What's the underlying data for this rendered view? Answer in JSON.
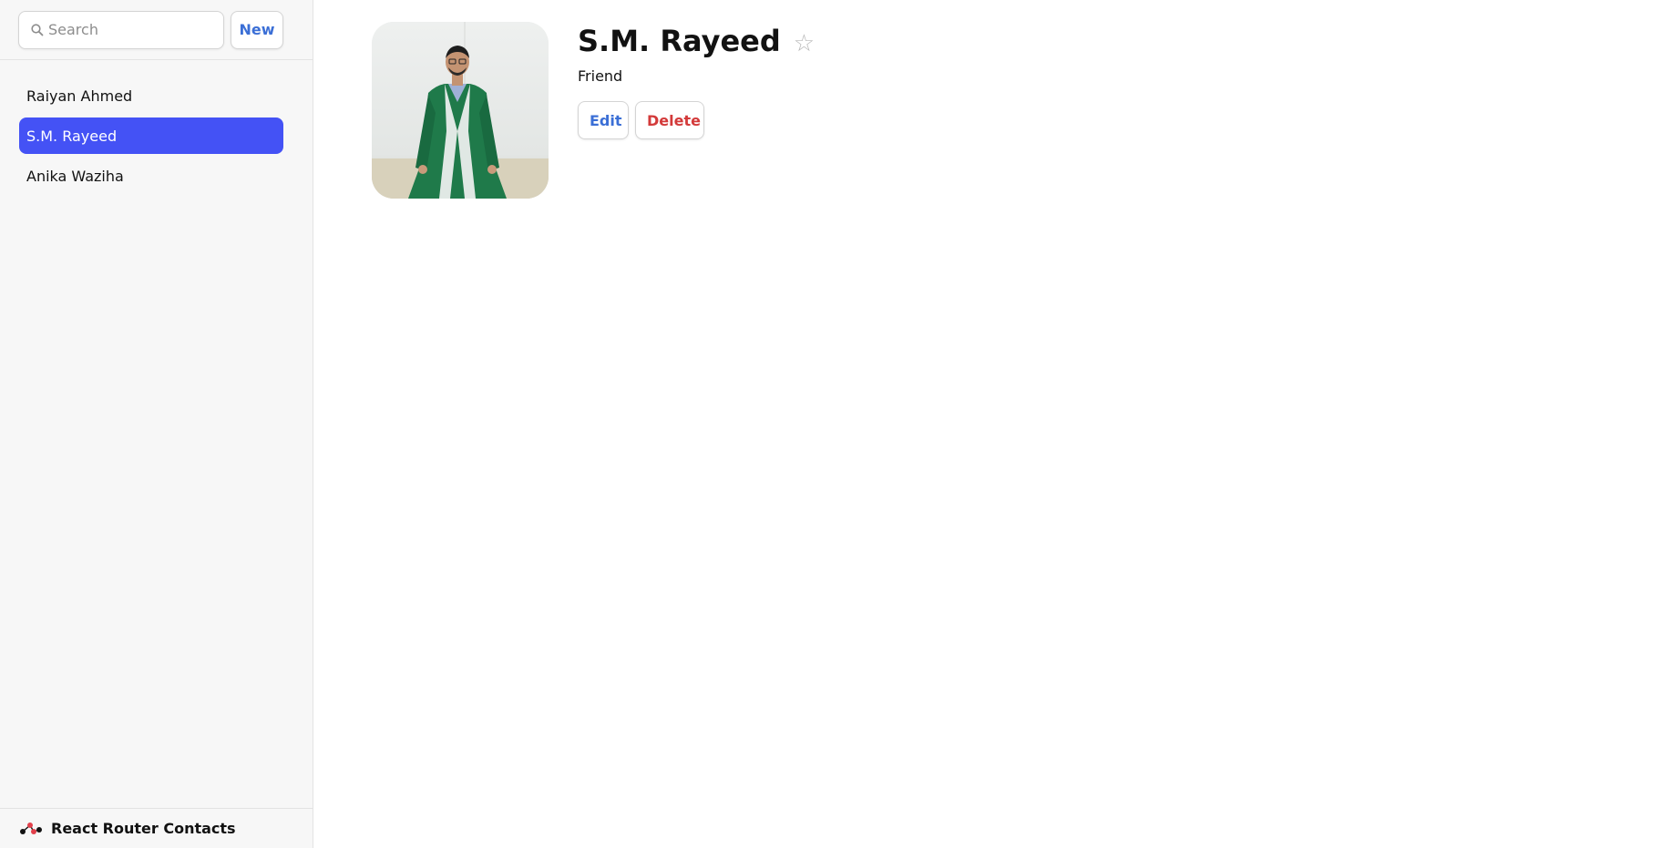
{
  "sidebar": {
    "search": {
      "placeholder": "Search",
      "value": ""
    },
    "new_label": "New",
    "contacts": [
      {
        "label": "Raiyan Ahmed",
        "active": false
      },
      {
        "label": "S.M. Rayeed",
        "active": true
      },
      {
        "label": "Anika Waziha",
        "active": false
      }
    ],
    "footer_title": "React Router Contacts"
  },
  "contact": {
    "name": "S.M. Rayeed",
    "relation": "Friend",
    "favorite": false,
    "favorite_glyph": "☆",
    "edit_label": "Edit",
    "delete_label": "Delete"
  },
  "colors": {
    "accent": "#4452f5",
    "link": "#3b6fd6",
    "danger": "#d33a3a",
    "gown": "#1f7a4a"
  },
  "icons": {
    "search": "search-icon",
    "favorite": "star-outline-icon",
    "logo": "react-router-logo-icon"
  }
}
